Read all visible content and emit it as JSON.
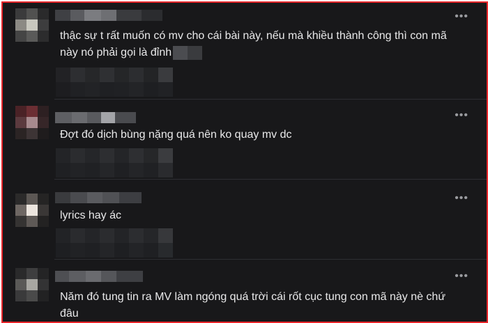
{
  "comments": [
    {
      "text": "thậc sự t rất muốn có mv cho cái bài này, nếu mà khiều thành công thì con mã này nó phải gọi là đỉnh",
      "more_icon": "more-horizontal-icon"
    },
    {
      "text": "Đợt đó dịch bùng nặng quá nên ko quay mv dc",
      "more_icon": "more-horizontal-icon"
    },
    {
      "text": "lyrics hay ác",
      "more_icon": "more-horizontal-icon"
    },
    {
      "text": "Năm đó tung tin ra MV làm ngóng quá trời cái rốt cục tung con mã này nè chứ đâu",
      "more_icon": "more-horizontal-icon"
    }
  ],
  "more_glyph": "•••",
  "colors": {
    "background": "#18181a",
    "frame_border": "#e8262a",
    "text": "#e9e9ea"
  }
}
